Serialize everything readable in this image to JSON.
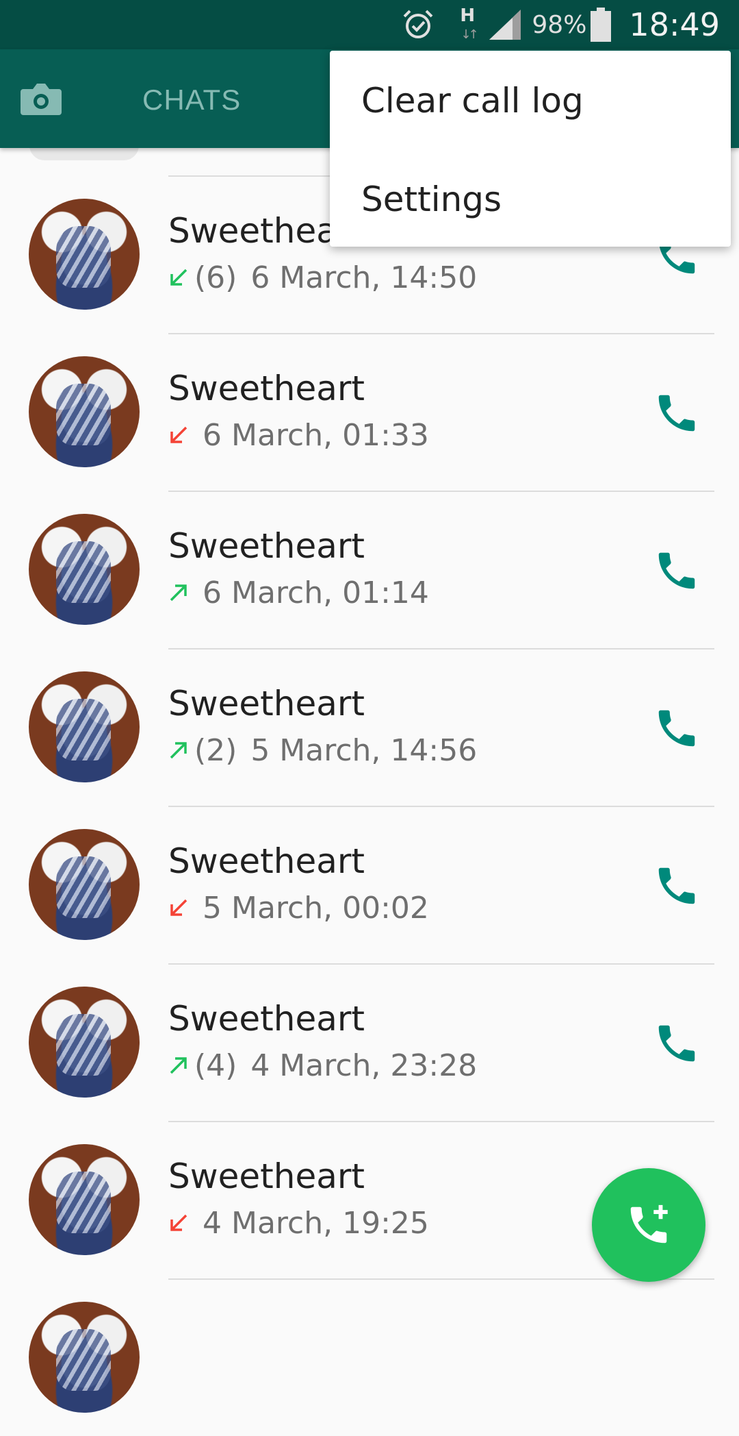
{
  "status_bar": {
    "battery_percent": "98%",
    "time": "18:49",
    "network_type": "H",
    "icons": [
      "alarm-icon",
      "network-h-icon",
      "signal-icon",
      "battery-icon"
    ]
  },
  "app_bar": {
    "camera_icon": "camera-icon",
    "tab_chats": "CHATS"
  },
  "menu": {
    "items": [
      {
        "label": "Clear call log"
      },
      {
        "label": "Settings"
      }
    ]
  },
  "calls": [
    {
      "name": "Sweetheart",
      "direction": "incoming",
      "count": "(6)",
      "time": "6 March, 14:50",
      "arrow_color": "#20c15d"
    },
    {
      "name": "Sweetheart",
      "direction": "missed",
      "count": "",
      "time": "6 March, 01:33",
      "arrow_color": "#f44336"
    },
    {
      "name": "Sweetheart",
      "direction": "outgoing",
      "count": "",
      "time": "6 March, 01:14",
      "arrow_color": "#20c15d"
    },
    {
      "name": "Sweetheart",
      "direction": "outgoing",
      "count": "(2)",
      "time": "5 March, 14:56",
      "arrow_color": "#20c15d"
    },
    {
      "name": "Sweetheart",
      "direction": "missed",
      "count": "",
      "time": "5 March, 00:02",
      "arrow_color": "#f44336"
    },
    {
      "name": "Sweetheart",
      "direction": "outgoing",
      "count": "(4)",
      "time": "4 March, 23:28",
      "arrow_color": "#20c15d"
    },
    {
      "name": "Sweetheart",
      "direction": "missed",
      "count": "",
      "time": "4 March, 19:25",
      "arrow_color": "#f44336"
    }
  ],
  "fab": {
    "icon": "new-call-icon"
  },
  "colors": {
    "status_bar": "#054d44",
    "app_bar": "#075e54",
    "accent": "#20c15d",
    "call_icon": "#00897b",
    "missed": "#f44336"
  }
}
